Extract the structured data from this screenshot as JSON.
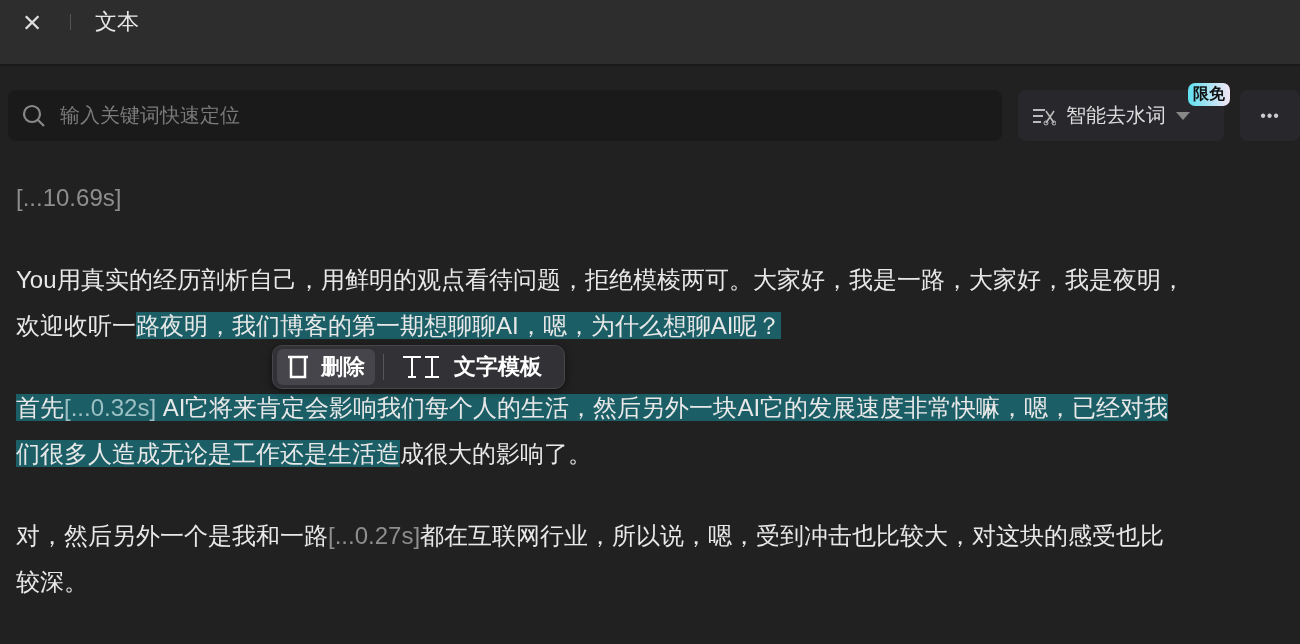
{
  "header": {
    "close_icon": "×",
    "title": "文本"
  },
  "search": {
    "placeholder": "输入关键词快速定位"
  },
  "filter_button": {
    "label": "智能去水词",
    "badge": "限免"
  },
  "more_button": {
    "label": "•••"
  },
  "paragraphs": [
    {
      "lines": [
        [
          {
            "kind": "pause",
            "text": "[...10.69s]",
            "selected": false
          }
        ]
      ]
    },
    {
      "lines": [
        [
          {
            "kind": "text",
            "text": "You用真实的经历剖析自己，用鲜明的观点看待问题，拒绝模棱两可。大家好，我是一路，大家好，我是夜明，",
            "selected": false
          }
        ],
        [
          {
            "kind": "text",
            "text": "欢迎收听一",
            "selected": false
          },
          {
            "kind": "text",
            "text": "路夜明，我们博客的第一期想聊聊AI，嗯，为什么想聊AI呢？ ",
            "selected": true
          }
        ]
      ]
    },
    {
      "lines": [
        [
          {
            "kind": "text",
            "text": "首先",
            "selected": true
          },
          {
            "kind": "pause",
            "text": "[...0.32s]",
            "selected": true
          },
          {
            "kind": "text",
            "text": " AI它将来肯定会影响我们每个人的生活，然后另外一块AI它的发展速度非常快嘛，嗯，已经对我",
            "selected": true
          }
        ],
        [
          {
            "kind": "text",
            "text": "们很多人造成无论是工作还是生活造",
            "selected": true
          },
          {
            "kind": "text",
            "text": "成很大的影响了。",
            "selected": false
          }
        ]
      ]
    },
    {
      "lines": [
        [
          {
            "kind": "text",
            "text": "对，然后另外一个是我和一路",
            "selected": false
          },
          {
            "kind": "pause",
            "text": "[...0.27s]",
            "selected": false
          },
          {
            "kind": "text",
            "text": "都在互联网行业，所以说，嗯，受到冲击也比较大，对这块的感受也比",
            "selected": false
          }
        ],
        [
          {
            "kind": "text",
            "text": "较深。",
            "selected": false
          }
        ]
      ]
    }
  ],
  "popup": {
    "actions": [
      {
        "label": "删除",
        "kind": "delete",
        "selected": true
      },
      {
        "label": "文字模板",
        "kind": "template",
        "selected": false
      }
    ]
  }
}
